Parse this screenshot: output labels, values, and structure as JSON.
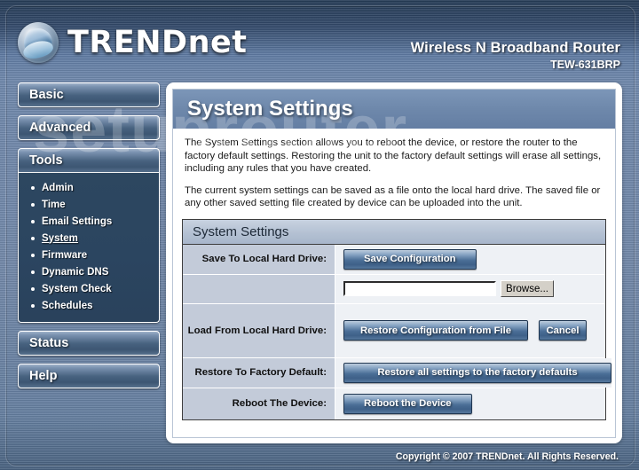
{
  "header": {
    "brand": "TRENDnet",
    "logo_icon": "trendnet-globe-logo-icon",
    "product_name": "Wireless N Broadband Router",
    "model": "TEW-631BRP"
  },
  "watermark": "setuprouter",
  "sidebar": {
    "buttons": [
      {
        "label": "Basic"
      },
      {
        "label": "Advanced"
      }
    ],
    "group": {
      "label": "Tools"
    },
    "tools": [
      {
        "label": "Admin",
        "active": false
      },
      {
        "label": "Time",
        "active": false
      },
      {
        "label": "Email Settings",
        "active": false
      },
      {
        "label": "System",
        "active": true
      },
      {
        "label": "Firmware",
        "active": false
      },
      {
        "label": "Dynamic DNS",
        "active": false
      },
      {
        "label": "System Check",
        "active": false
      },
      {
        "label": "Schedules",
        "active": false
      }
    ],
    "bottom_buttons": [
      {
        "label": "Status"
      },
      {
        "label": "Help"
      }
    ]
  },
  "main": {
    "title": "System Settings",
    "paragraph1": "The System Settings section allows you to reboot the device, or restore the router to the factory default settings. Restoring the unit to the factory default settings will erase all settings, including any rules that you have created.",
    "paragraph2": "The current system settings can be saved as a file onto the local hard drive. The saved file or any other saved setting file created by device can be uploaded into the unit.",
    "panel_title": "System Settings",
    "rows": {
      "save": {
        "label": "Save To Local Hard Drive:",
        "button": "Save Configuration"
      },
      "file": {
        "value": "",
        "placeholder": "",
        "browse_button": "Browse..."
      },
      "load": {
        "label": "Load From Local Hard Drive:",
        "restore_button": "Restore Configuration from File",
        "cancel_button": "Cancel"
      },
      "factory": {
        "label": "Restore To Factory Default:",
        "button": "Restore all settings to the factory defaults"
      },
      "reboot": {
        "label": "Reboot The Device:",
        "button": "Reboot the Device"
      }
    }
  },
  "footer": {
    "copyright": "Copyright © 2007 TRENDnet. All Rights Reserved."
  },
  "colors": {
    "accent_blue": "#4a6e96",
    "header_band": "#6e88ab",
    "label_cell": "#c3cbd9",
    "page_bg": "#6e87ab"
  }
}
